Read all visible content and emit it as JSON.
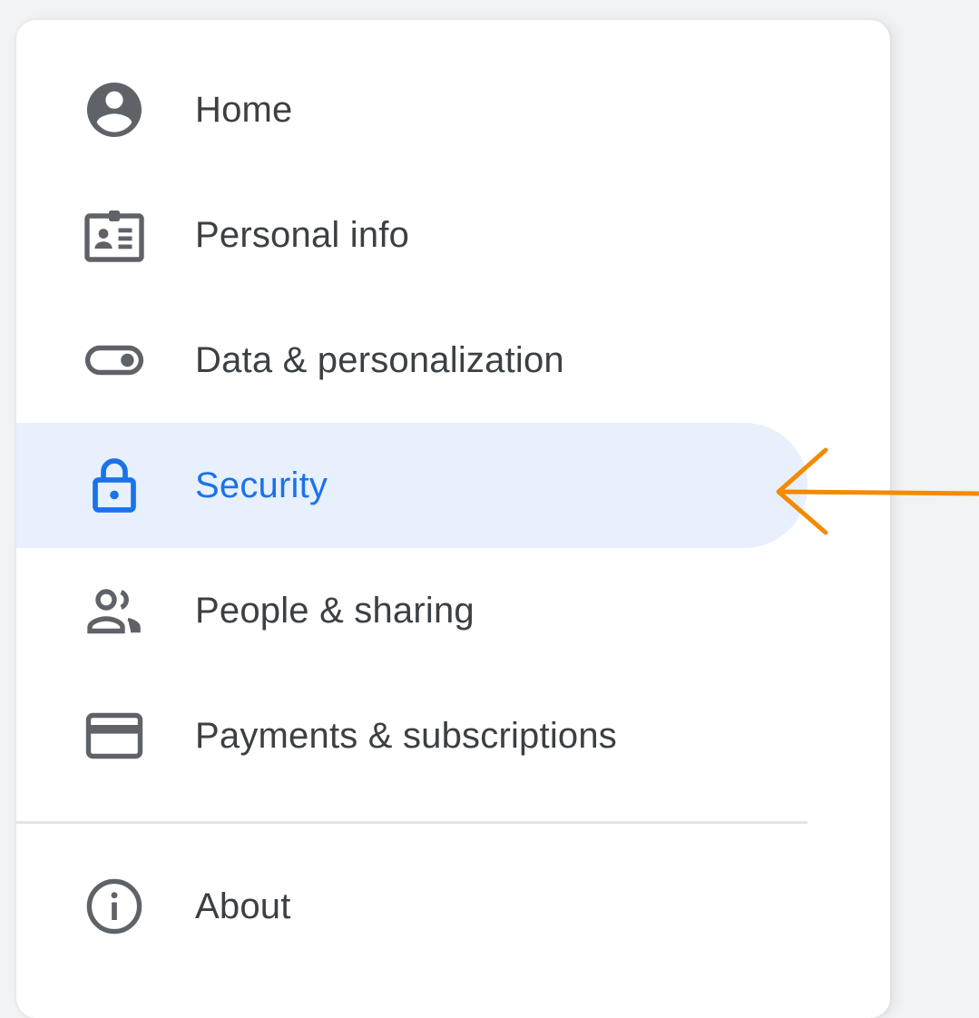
{
  "accent_color": "#1a73e8",
  "active_background": "#e8f0fe",
  "icon_color": "#5f6368",
  "annotation_color": "#f28b00",
  "nav": {
    "items": [
      {
        "label": "Home",
        "icon": "account-circle-icon",
        "active": false
      },
      {
        "label": "Personal info",
        "icon": "id-card-icon",
        "active": false
      },
      {
        "label": "Data & personalization",
        "icon": "toggle-icon",
        "active": false
      },
      {
        "label": "Security",
        "icon": "lock-icon",
        "active": true
      },
      {
        "label": "People & sharing",
        "icon": "people-icon",
        "active": false
      },
      {
        "label": "Payments & subscriptions",
        "icon": "credit-card-icon",
        "active": false
      }
    ],
    "footer_items": [
      {
        "label": "About",
        "icon": "info-icon",
        "active": false
      }
    ]
  },
  "annotation": {
    "icon": "arrow-left-icon"
  }
}
